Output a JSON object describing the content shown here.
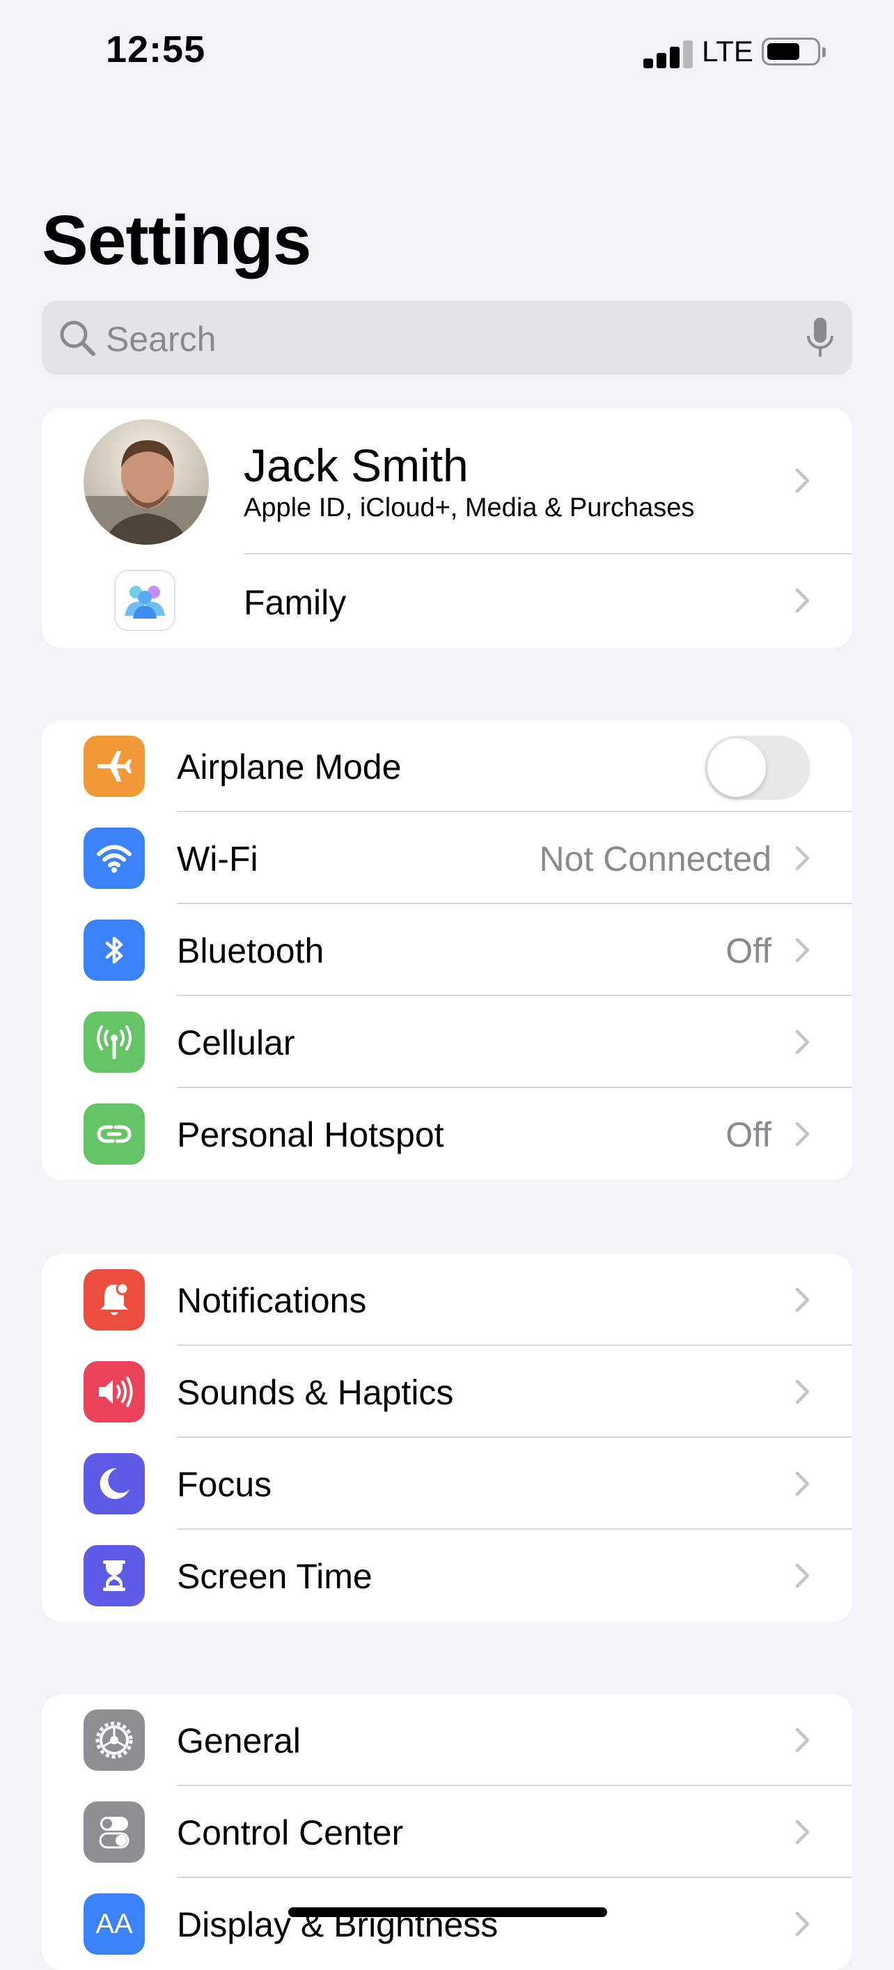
{
  "status_bar": {
    "time": "12:55",
    "network": "LTE"
  },
  "page": {
    "title": "Settings"
  },
  "search": {
    "placeholder": "Search"
  },
  "profile": {
    "name": "Jack Smith",
    "subtitle": "Apple ID, iCloud+, Media & Purchases",
    "family_label": "Family"
  },
  "connectivity": [
    {
      "label": "Airplane Mode",
      "value": "",
      "icon": "airplane-icon",
      "color": "#f19a37",
      "toggle": false
    },
    {
      "label": "Wi-Fi",
      "value": "Not Connected",
      "icon": "wifi-icon",
      "color": "#3b82f6"
    },
    {
      "label": "Bluetooth",
      "value": "Off",
      "icon": "bluetooth-icon",
      "color": "#3b82f6"
    },
    {
      "label": "Cellular",
      "value": "",
      "icon": "antenna-icon",
      "color": "#65c466"
    },
    {
      "label": "Personal Hotspot",
      "value": "Off",
      "icon": "hotspot-icon",
      "color": "#65c466"
    }
  ],
  "notifications_group": [
    {
      "label": "Notifications",
      "icon": "bell-icon",
      "color": "#eb4e3d"
    },
    {
      "label": "Sounds & Haptics",
      "icon": "speaker-icon",
      "color": "#eb445a"
    },
    {
      "label": "Focus",
      "icon": "moon-icon",
      "color": "#5e5ce6"
    },
    {
      "label": "Screen Time",
      "icon": "hourglass-icon",
      "color": "#5e5ce6"
    }
  ],
  "general_group": [
    {
      "label": "General",
      "icon": "gear-icon",
      "color": "#8e8e93"
    },
    {
      "label": "Control Center",
      "icon": "switches-icon",
      "color": "#8e8e93"
    },
    {
      "label": "Display & Brightness",
      "icon": "text-size-icon",
      "color": "#3b82f6",
      "icon_text": "AA"
    }
  ]
}
